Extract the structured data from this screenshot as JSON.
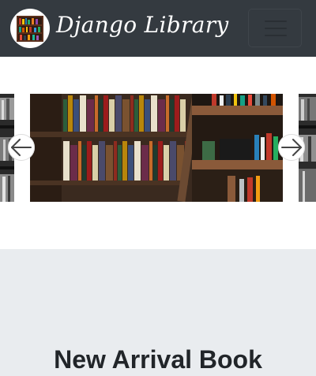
{
  "navbar": {
    "brand": "Django Library",
    "logo_icon": "bookshelf-logo-icon",
    "toggler_icon": "hamburger-menu-icon"
  },
  "carousel": {
    "prev_icon": "arrow-left-icon",
    "next_icon": "arrow-right-icon",
    "slide_image": "bookshelf-photo",
    "indicator_count": 3
  },
  "section": {
    "title": "New Arrival Book"
  },
  "colors": {
    "navbar_bg": "#343a40",
    "section_bg": "#e9ecef"
  }
}
